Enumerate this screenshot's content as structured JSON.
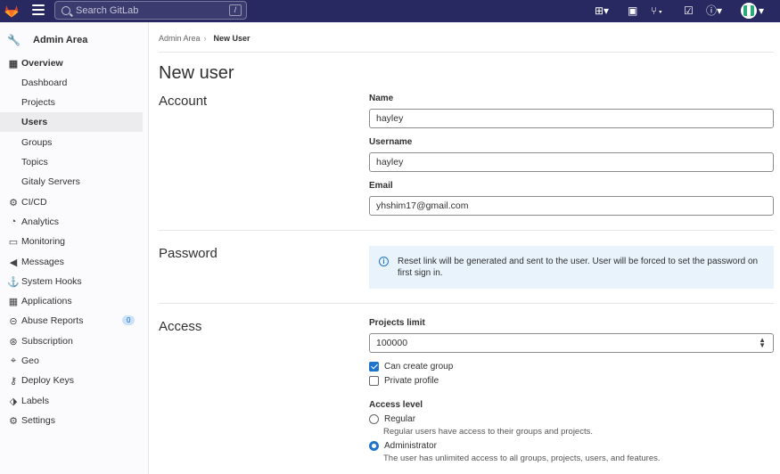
{
  "colors": {
    "navbar": "#292961",
    "accent": "#1f75cb",
    "alert_bg": "#e9f3fc"
  },
  "topbar": {
    "search_placeholder": "Search GitLab",
    "search_shortcut": "/",
    "icons": [
      "gitlab-logo-icon",
      "hamburger-icon",
      "plus-icon",
      "issues-icon",
      "merge-requests-icon",
      "todo-icon",
      "help-icon",
      "avatar-icon"
    ]
  },
  "sidebar": {
    "title": "Admin Area",
    "items": [
      {
        "label": "Overview",
        "icon": "overview-icon"
      },
      {
        "label": "Dashboard"
      },
      {
        "label": "Projects"
      },
      {
        "label": "Users"
      },
      {
        "label": "Groups"
      },
      {
        "label": "Topics"
      },
      {
        "label": "Gitaly Servers"
      },
      {
        "label": "CI/CD",
        "icon": "rocket-icon"
      },
      {
        "label": "Analytics",
        "icon": "analytics-icon"
      },
      {
        "label": "Monitoring",
        "icon": "monitor-icon"
      },
      {
        "label": "Messages",
        "icon": "messages-icon"
      },
      {
        "label": "System Hooks",
        "icon": "hook-icon"
      },
      {
        "label": "Applications",
        "icon": "applications-icon"
      },
      {
        "label": "Abuse Reports",
        "icon": "abuse-icon",
        "badge": "0"
      },
      {
        "label": "Subscription",
        "icon": "subscription-icon"
      },
      {
        "label": "Geo",
        "icon": "geo-icon"
      },
      {
        "label": "Deploy Keys",
        "icon": "key-icon"
      },
      {
        "label": "Labels",
        "icon": "label-icon"
      },
      {
        "label": "Settings",
        "icon": "settings-icon"
      }
    ]
  },
  "breadcrumb": {
    "parent": "Admin Area",
    "current": "New User"
  },
  "page_title": "New user",
  "account": {
    "title": "Account",
    "name_label": "Name",
    "name_value": "hayley",
    "username_label": "Username",
    "username_value": "hayley",
    "email_label": "Email",
    "email_value": "yhshim17@gmail.com"
  },
  "password": {
    "title": "Password",
    "alert": "Reset link will be generated and sent to the user. User will be forced to set the password on first sign in."
  },
  "access": {
    "title": "Access",
    "projects_limit_label": "Projects limit",
    "projects_limit_value": "100000",
    "can_create_group": "Can create group",
    "can_create_group_checked": true,
    "private_profile": "Private profile",
    "private_profile_checked": false,
    "level_label": "Access level",
    "regular_label": "Regular",
    "regular_help": "Regular users have access to their groups and projects.",
    "admin_label": "Administrator",
    "admin_help": "The user has unlimited access to all groups, projects, users, and features.",
    "selected_level": "Administrator"
  }
}
